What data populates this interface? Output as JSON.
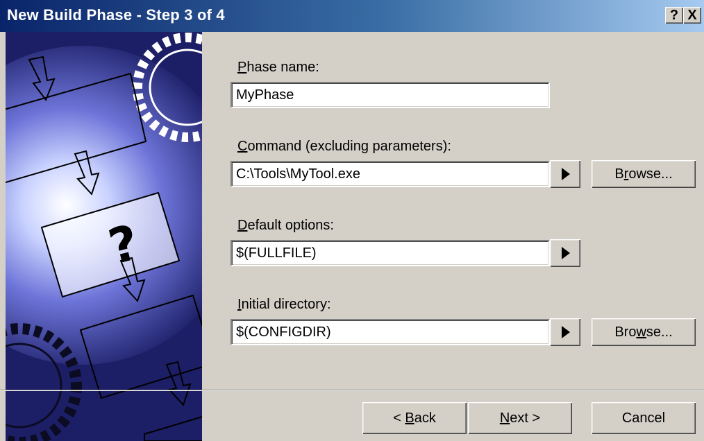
{
  "window": {
    "title": "New Build Phase - Step 3 of 4",
    "help_glyph": "?",
    "close_glyph": "X"
  },
  "fields": {
    "phase_name": {
      "label_prefix": "",
      "label_mnemonic": "P",
      "label_rest": "hase name:",
      "value": "MyPhase"
    },
    "command": {
      "label_prefix": "",
      "label_mnemonic": "C",
      "label_rest": "ommand (excluding parameters):",
      "value": "C:\\Tools\\MyTool.exe"
    },
    "default_options": {
      "label_prefix": "",
      "label_mnemonic": "D",
      "label_rest": "efault options:",
      "value": "$(FULLFILE)"
    },
    "initial_directory": {
      "label_prefix": "",
      "label_mnemonic": "I",
      "label_rest": "nitial directory:",
      "value": "$(CONFIGDIR)"
    }
  },
  "buttons": {
    "browse_command": {
      "prefix": "B",
      "mnemonic": "r",
      "rest": "owse..."
    },
    "browse_directory": {
      "prefix": "Bro",
      "mnemonic": "w",
      "rest": "se..."
    },
    "back": {
      "prefix": "< ",
      "mnemonic": "B",
      "rest": "ack"
    },
    "next": {
      "prefix": "",
      "mnemonic": "N",
      "rest": "ext >"
    },
    "cancel": {
      "label": "Cancel"
    }
  },
  "icons": {
    "arrow": "arrow-right-icon",
    "help": "help-icon",
    "close": "close-icon"
  },
  "art": {
    "question_glyph": "?"
  }
}
